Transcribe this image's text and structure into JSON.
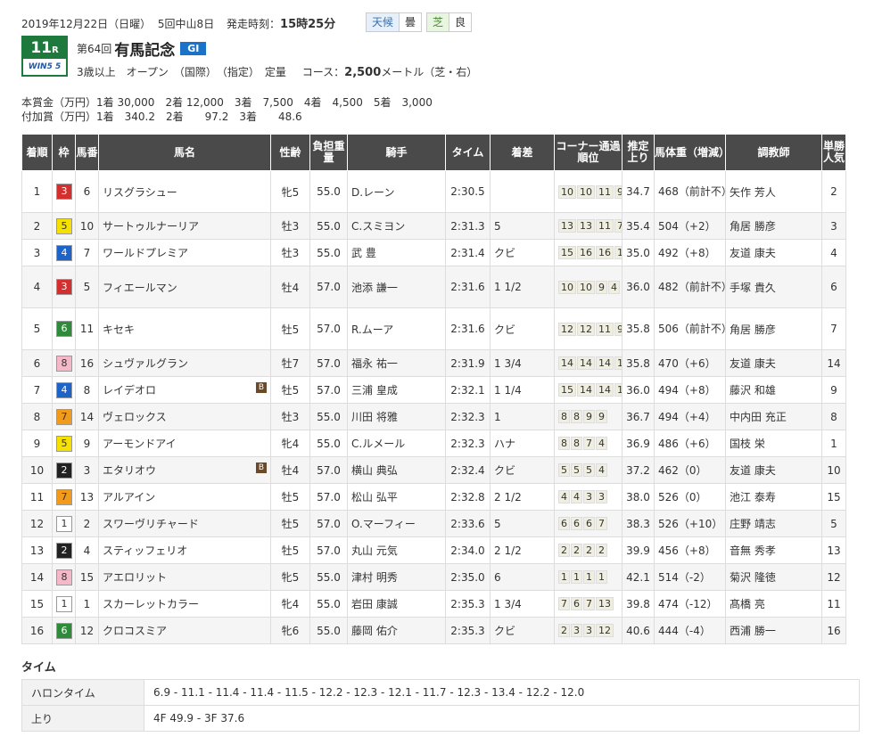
{
  "header": {
    "date": "2019年12月22日（日曜）",
    "meeting": "5回中山8日",
    "post_label": "発走時刻：",
    "post_time": "15時25分",
    "weather_label": "天候",
    "weather": "曇",
    "track_label": "芝",
    "track_cond": "良"
  },
  "race": {
    "number": "11",
    "r": "R",
    "win5": "WIN5 5",
    "kai": "第64回",
    "name": "有馬記念",
    "grade": "GI",
    "cond": "3歳以上　オープン　（国際）　（指定）　定量",
    "course_label": "コース：",
    "distance": "2,500",
    "course_unit": "メートル（芝・右）"
  },
  "prize": {
    "line1": "本賞金（万円）1着 30,000　2着 12,000　3着　7,500　4着　4,500　5着　3,000",
    "line2": "付加賞（万円）1着　340.2　2着　　97.2　3着　　48.6"
  },
  "table": {
    "headers": [
      "着順",
      "枠",
      "馬番",
      "馬名",
      "性齢",
      "負担重量",
      "騎手",
      "タイム",
      "着差",
      "コーナー通過順位",
      "推定上り",
      "馬体重（増減）",
      "調教師",
      "単勝人気"
    ],
    "rows": [
      {
        "pos": "1",
        "waku": "3",
        "num": "6",
        "horse": "リスグラシュー",
        "b": "",
        "sex": "牝5",
        "wt": "55.0",
        "jockey": "D.レーン",
        "time": "2:30.5",
        "margin": "",
        "c": [
          "10",
          "10",
          "11",
          "9"
        ],
        "last": "34.7",
        "body": "468（前計不）",
        "trainer": "矢作 芳人",
        "pop": "2"
      },
      {
        "pos": "2",
        "waku": "5",
        "num": "10",
        "horse": "サートゥルナーリア",
        "b": "",
        "sex": "牡3",
        "wt": "55.0",
        "jockey": "C.スミヨン",
        "time": "2:31.3",
        "margin": "5",
        "c": [
          "13",
          "13",
          "11",
          "7"
        ],
        "last": "35.4",
        "body": "504（+2）",
        "trainer": "角居 勝彦",
        "pop": "3"
      },
      {
        "pos": "3",
        "waku": "4",
        "num": "7",
        "horse": "ワールドプレミア",
        "b": "",
        "sex": "牡3",
        "wt": "55.0",
        "jockey": "武 豊",
        "time": "2:31.4",
        "margin": "クビ",
        "c": [
          "15",
          "16",
          "16",
          "16"
        ],
        "last": "35.0",
        "body": "492（+8）",
        "trainer": "友道 康夫",
        "pop": "4"
      },
      {
        "pos": "4",
        "waku": "3",
        "num": "5",
        "horse": "フィエールマン",
        "b": "",
        "sex": "牡4",
        "wt": "57.0",
        "jockey": "池添 謙一",
        "time": "2:31.6",
        "margin": "1 1/2",
        "c": [
          "10",
          "10",
          "9",
          "4"
        ],
        "last": "36.0",
        "body": "482（前計不）",
        "trainer": "手塚 貴久",
        "pop": "6"
      },
      {
        "pos": "5",
        "waku": "6",
        "num": "11",
        "horse": "キセキ",
        "b": "",
        "sex": "牡5",
        "wt": "57.0",
        "jockey": "R.ムーア",
        "time": "2:31.6",
        "margin": "クビ",
        "c": [
          "12",
          "12",
          "11",
          "9"
        ],
        "last": "35.8",
        "body": "506（前計不）",
        "trainer": "角居 勝彦",
        "pop": "7"
      },
      {
        "pos": "6",
        "waku": "8",
        "num": "16",
        "horse": "シュヴァルグラン",
        "b": "",
        "sex": "牡7",
        "wt": "57.0",
        "jockey": "福永 祐一",
        "time": "2:31.9",
        "margin": "1 3/4",
        "c": [
          "14",
          "14",
          "14",
          "13"
        ],
        "last": "35.8",
        "body": "470（+6）",
        "trainer": "友道 康夫",
        "pop": "14"
      },
      {
        "pos": "7",
        "waku": "4",
        "num": "8",
        "horse": "レイデオロ",
        "b": "B",
        "sex": "牡5",
        "wt": "57.0",
        "jockey": "三浦 皇成",
        "time": "2:32.1",
        "margin": "1 1/4",
        "c": [
          "15",
          "14",
          "14",
          "13"
        ],
        "last": "36.0",
        "body": "494（+8）",
        "trainer": "藤沢 和雄",
        "pop": "9"
      },
      {
        "pos": "8",
        "waku": "7",
        "num": "14",
        "horse": "ヴェロックス",
        "b": "",
        "sex": "牡3",
        "wt": "55.0",
        "jockey": "川田 将雅",
        "time": "2:32.3",
        "margin": "1",
        "c": [
          "8",
          "8",
          "9",
          "9"
        ],
        "last": "36.7",
        "body": "494（+4）",
        "trainer": "中内田 充正",
        "pop": "8"
      },
      {
        "pos": "9",
        "waku": "5",
        "num": "9",
        "horse": "アーモンドアイ",
        "b": "",
        "sex": "牝4",
        "wt": "55.0",
        "jockey": "C.ルメール",
        "time": "2:32.3",
        "margin": "ハナ",
        "c": [
          "8",
          "8",
          "7",
          "4"
        ],
        "last": "36.9",
        "body": "486（+6）",
        "trainer": "国枝 栄",
        "pop": "1"
      },
      {
        "pos": "10",
        "waku": "2",
        "num": "3",
        "horse": "エタリオウ",
        "b": "B",
        "sex": "牡4",
        "wt": "57.0",
        "jockey": "横山 典弘",
        "time": "2:32.4",
        "margin": "クビ",
        "c": [
          "5",
          "5",
          "5",
          "4"
        ],
        "last": "37.2",
        "body": "462（0）",
        "trainer": "友道 康夫",
        "pop": "10"
      },
      {
        "pos": "11",
        "waku": "7",
        "num": "13",
        "horse": "アルアイン",
        "b": "",
        "sex": "牡5",
        "wt": "57.0",
        "jockey": "松山 弘平",
        "time": "2:32.8",
        "margin": "2 1/2",
        "c": [
          "4",
          "4",
          "3",
          "3"
        ],
        "last": "38.0",
        "body": "526（0）",
        "trainer": "池江 泰寿",
        "pop": "15"
      },
      {
        "pos": "12",
        "waku": "1",
        "num": "2",
        "horse": "スワーヴリチャード",
        "b": "",
        "sex": "牡5",
        "wt": "57.0",
        "jockey": "O.マーフィー",
        "time": "2:33.6",
        "margin": "5",
        "c": [
          "6",
          "6",
          "6",
          "7"
        ],
        "last": "38.3",
        "body": "526（+10）",
        "trainer": "庄野 靖志",
        "pop": "5"
      },
      {
        "pos": "13",
        "waku": "2",
        "num": "4",
        "horse": "スティッフェリオ",
        "b": "",
        "sex": "牡5",
        "wt": "57.0",
        "jockey": "丸山 元気",
        "time": "2:34.0",
        "margin": "2 1/2",
        "c": [
          "2",
          "2",
          "2",
          "2"
        ],
        "last": "39.9",
        "body": "456（+8）",
        "trainer": "音無 秀孝",
        "pop": "13"
      },
      {
        "pos": "14",
        "waku": "8",
        "num": "15",
        "horse": "アエロリット",
        "b": "",
        "sex": "牝5",
        "wt": "55.0",
        "jockey": "津村 明秀",
        "time": "2:35.0",
        "margin": "6",
        "c": [
          "1",
          "1",
          "1",
          "1"
        ],
        "last": "42.1",
        "body": "514（-2）",
        "trainer": "菊沢 隆徳",
        "pop": "12"
      },
      {
        "pos": "15",
        "waku": "1",
        "num": "1",
        "horse": "スカーレットカラー",
        "b": "",
        "sex": "牝4",
        "wt": "55.0",
        "jockey": "岩田 康誠",
        "time": "2:35.3",
        "margin": "1 3/4",
        "c": [
          "7",
          "6",
          "7",
          "13"
        ],
        "last": "39.8",
        "body": "474（-12）",
        "trainer": "髙橋 亮",
        "pop": "11"
      },
      {
        "pos": "16",
        "waku": "6",
        "num": "12",
        "horse": "クロコスミア",
        "b": "",
        "sex": "牝6",
        "wt": "55.0",
        "jockey": "藤岡 佑介",
        "time": "2:35.3",
        "margin": "クビ",
        "c": [
          "2",
          "3",
          "3",
          "12"
        ],
        "last": "40.6",
        "body": "444（-4）",
        "trainer": "西浦 勝一",
        "pop": "16"
      }
    ]
  },
  "laps": {
    "title": "タイム",
    "furlong_label": "ハロンタイム",
    "furlong": "6.9 - 11.1 - 11.4 - 11.4 - 11.5 - 12.2 - 12.3 - 12.1 - 11.7 - 12.3 - 13.4 - 12.2 - 12.0",
    "last_label": "上り",
    "last": "4F 49.9 - 3F 37.6"
  },
  "colors": {
    "waku": {
      "1": "#ffffff",
      "2": "#222222",
      "3": "#d32f2f",
      "4": "#1e64c8",
      "5": "#f5e000",
      "6": "#2e8b3a",
      "7": "#f29a1a",
      "8": "#f6b8c8"
    },
    "waku_text": {
      "1": "#333333",
      "2": "#ffffff",
      "3": "#ffffff",
      "4": "#ffffff",
      "5": "#333333",
      "6": "#ffffff",
      "7": "#333333",
      "8": "#333333"
    }
  }
}
